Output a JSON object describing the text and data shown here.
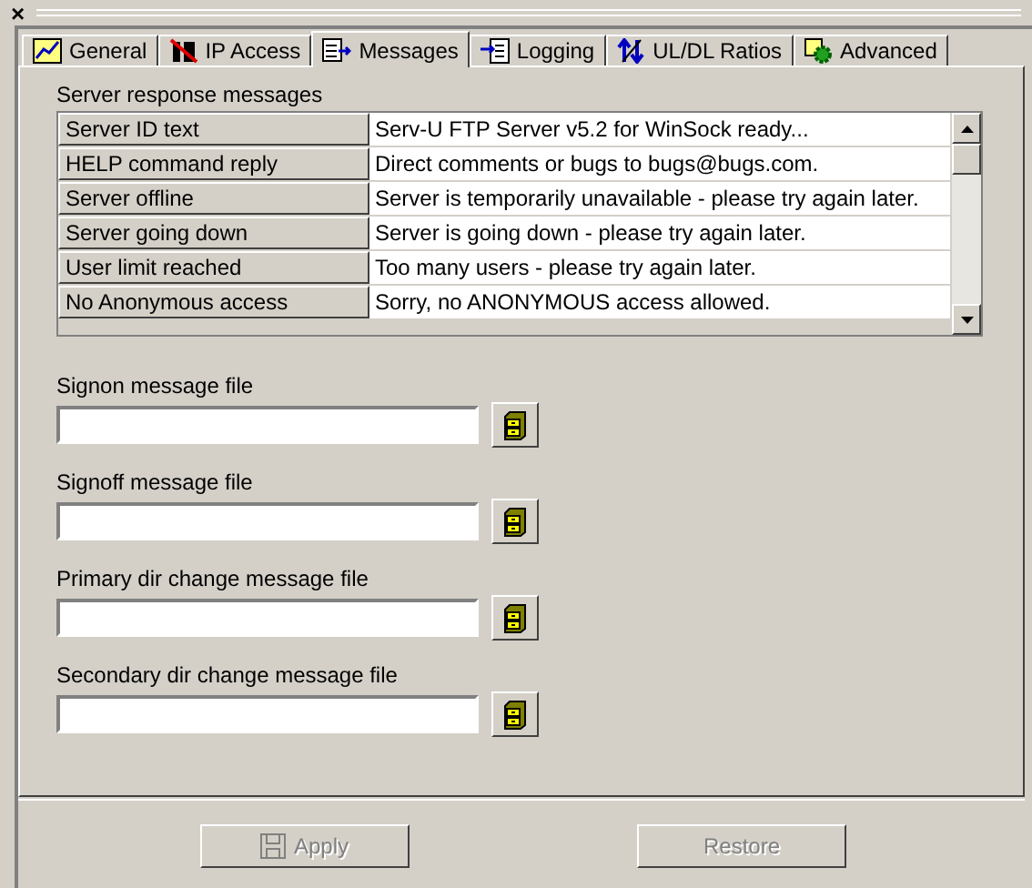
{
  "close_glyph": "×",
  "tabs": [
    {
      "label": "General",
      "selected": false
    },
    {
      "label": "IP Access",
      "selected": false
    },
    {
      "label": "Messages",
      "selected": true
    },
    {
      "label": "Logging",
      "selected": false
    },
    {
      "label": "UL/DL Ratios",
      "selected": false
    },
    {
      "label": "Advanced",
      "selected": false
    }
  ],
  "messages_group": {
    "label": "Server response messages",
    "rows": [
      {
        "name": "Server ID text",
        "message": "Serv-U FTP Server v5.2 for WinSock ready..."
      },
      {
        "name": "HELP command reply",
        "message": "Direct comments or bugs to bugs@bugs.com."
      },
      {
        "name": "Server offline",
        "message": "Server is temporarily unavailable - please try again later."
      },
      {
        "name": "Server going down",
        "message": "Server is going down - please try again later."
      },
      {
        "name": "User limit reached",
        "message": "Too many users - please try again later."
      },
      {
        "name": "No Anonymous access",
        "message": "Sorry, no ANONYMOUS access allowed."
      }
    ]
  },
  "file_fields": [
    {
      "label": "Signon message file"
    },
    {
      "label": "Signoff message file"
    },
    {
      "label": "Primary dir change message file"
    },
    {
      "label": "Secondary dir change message file"
    }
  ],
  "buttons": [
    {
      "label": "Apply",
      "disabled": true,
      "kind": "icon"
    },
    {
      "label": "Restore",
      "disabled": true,
      "kind": "text"
    }
  ]
}
